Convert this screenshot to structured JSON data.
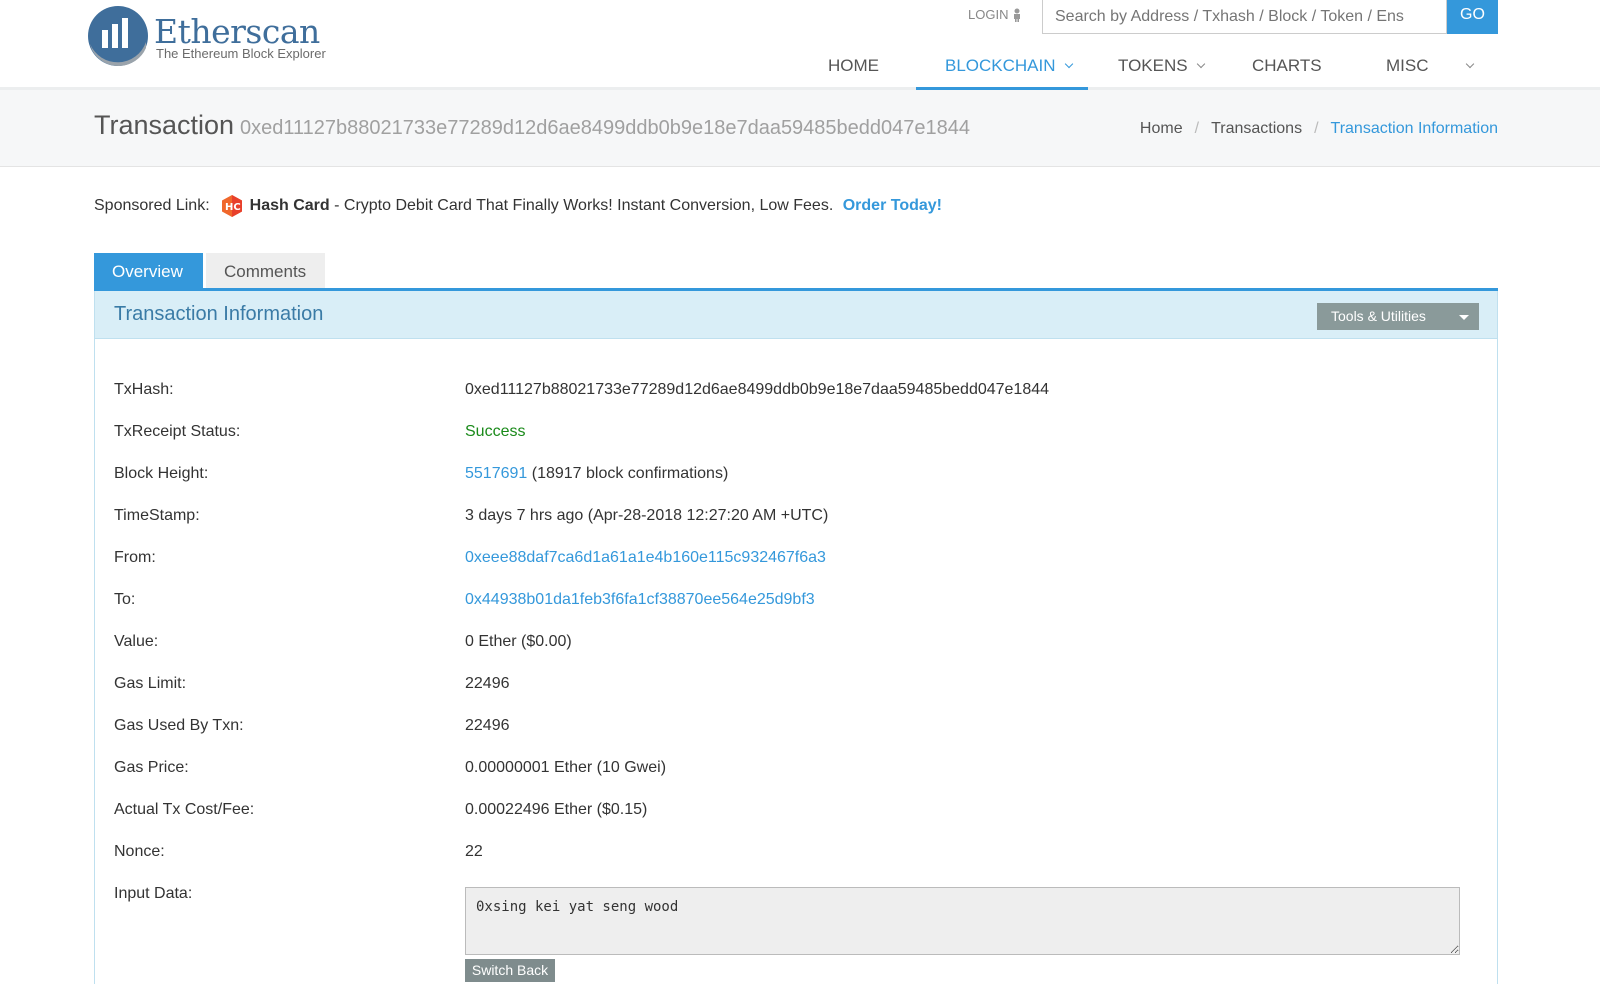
{
  "brand": {
    "name": "Etherscan",
    "tagline": "The Ethereum Block Explorer"
  },
  "header": {
    "login_label": "LOGIN",
    "search_placeholder": "Search by Address / Txhash / Block / Token / Ens",
    "search_button": "GO",
    "nav": [
      "HOME",
      "BLOCKCHAIN",
      "TOKENS",
      "CHARTS",
      "MISC"
    ],
    "active_nav": "BLOCKCHAIN"
  },
  "title_bar": {
    "title": "Transaction",
    "hash": "0xed11127b88021733e77289d12d6ae8499ddb0b9e18e7daa59485bedd047e1844",
    "breadcrumb": [
      "Home",
      "Transactions",
      "Transaction Information"
    ]
  },
  "sponsor": {
    "prefix": "Sponsored Link:",
    "brand": "Hash Card",
    "text": " - Crypto Debit Card That Finally Works! Instant Conversion, Low Fees. ",
    "cta": "Order Today!"
  },
  "tabs": [
    "Overview",
    "Comments"
  ],
  "panel": {
    "title": "Transaction Information",
    "tools_label": "Tools & Utilities"
  },
  "tx": {
    "labels": {
      "hash": "TxHash:",
      "status": "TxReceipt Status:",
      "block": "Block Height:",
      "timestamp": "TimeStamp:",
      "from": "From:",
      "to": "To:",
      "value": "Value:",
      "gas_limit": "Gas Limit:",
      "gas_used": "Gas Used By Txn:",
      "gas_price": "Gas Price:",
      "fee": "Actual Tx Cost/Fee:",
      "nonce": "Nonce:",
      "input": "Input Data:"
    },
    "hash": "0xed11127b88021733e77289d12d6ae8499ddb0b9e18e7daa59485bedd047e1844",
    "status": "Success",
    "block": "5517691",
    "confirmations": " (18917 block confirmations)",
    "timestamp": "3 days 7 hrs ago (Apr-28-2018 12:27:20 AM +UTC)",
    "from": "0xeee88daf7ca6d1a61a1e4b160e115c932467f6a3",
    "to": "0x44938b01da1feb3f6fa1cf38870ee564e25d9bf3",
    "value": "0 Ether ($0.00)",
    "gas_limit": "22496",
    "gas_used": "22496",
    "gas_price": "0.00000001 Ether (10 Gwei)",
    "fee": "0.00022496 Ether ($0.15)",
    "nonce": "22",
    "input_data": "0xsing kei yat seng wood",
    "switch_back": "Switch Back"
  },
  "colors": {
    "accent": "#3498db",
    "success": "#1a8a1a",
    "panel_head": "#d9eef7"
  }
}
